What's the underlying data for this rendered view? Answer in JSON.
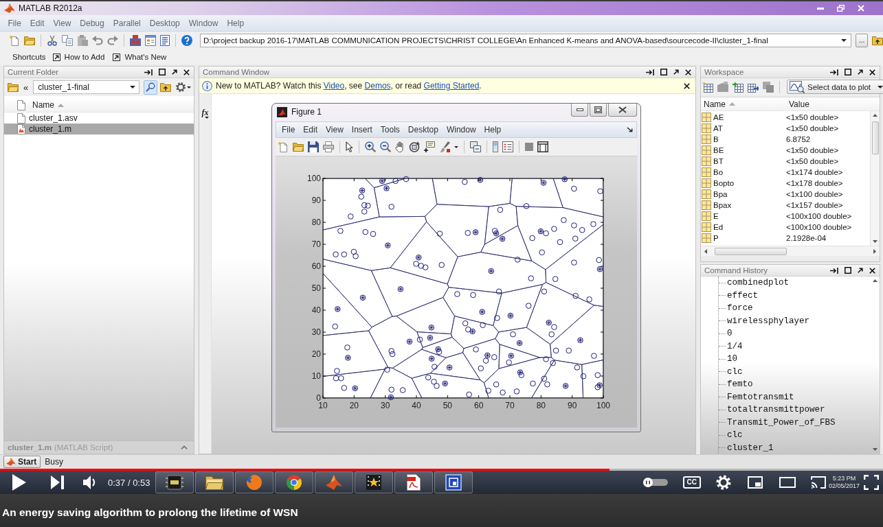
{
  "window": {
    "title": "MATLAB R2012a"
  },
  "menu": [
    "File",
    "Edit",
    "View",
    "Debug",
    "Parallel",
    "Desktop",
    "Window",
    "Help"
  ],
  "toolbar": {
    "current_folder": "D:\\project backup 2016-17\\MATLAB COMMUNICATION PROJECTS\\CHRIST COLLEGE\\An Enhanced K-means and ANOVA-based\\sourcecode-II\\cluster_1-final",
    "browse_button": "..."
  },
  "shortcuts": {
    "label": "Shortcuts",
    "links": [
      "How to Add",
      "What's New"
    ]
  },
  "current_folder": {
    "title": "Current Folder",
    "path_prefix": "«",
    "path": "cluster_1-final",
    "column": "Name",
    "files": [
      {
        "name": "cluster_1.asv",
        "kind": "file",
        "selected": false
      },
      {
        "name": "cluster_1.m",
        "kind": "script",
        "selected": true
      }
    ],
    "details": {
      "name": "cluster_1.m",
      "type": "(MATLAB Script)"
    }
  },
  "command_window": {
    "title": "Command Window",
    "notice": [
      {
        "kind": "text",
        "text": "New to MATLAB? Watch this "
      },
      {
        "kind": "link",
        "text": "Video"
      },
      {
        "kind": "text",
        "text": ", see "
      },
      {
        "kind": "link",
        "text": "Demos"
      },
      {
        "kind": "text",
        "text": ", or read "
      },
      {
        "kind": "link",
        "text": "Getting Started"
      },
      {
        "kind": "text",
        "text": "."
      }
    ],
    "function_browser": "fx"
  },
  "figure_window": {
    "title": "Figure 1",
    "menu": [
      "File",
      "Edit",
      "View",
      "Insert",
      "Tools",
      "Desktop",
      "Window",
      "Help"
    ],
    "chart_data": {
      "type": "scatter",
      "xlim": [
        10,
        100
      ],
      "ylim": [
        0,
        100
      ],
      "xticks": [
        10,
        20,
        30,
        40,
        50,
        60,
        70,
        80,
        90,
        100
      ],
      "yticks": [
        0,
        10,
        20,
        30,
        40,
        50,
        60,
        70,
        80,
        90,
        100
      ],
      "series": [
        {
          "color": "#1c1c78",
          "x": [
            36.7,
            33.3,
            55.5,
            22.3,
            23.3,
            24.4,
            23.3,
            32,
            18.9,
            15.6,
            23.6,
            26.1,
            14.1,
            16.8,
            19.9,
            20.5,
            39.9,
            41.5,
            42.9,
            48.1,
            47.5,
            56.5,
            66.9,
            75.3,
            90.6,
            99,
            87.3,
            90.6,
            93.2,
            96.8,
            84.2,
            81.6,
            77.2,
            91,
            86.1,
            80.3,
            90.6,
            98.6,
            72.5,
            76.8,
            84.6,
            66.5,
            58.2,
            53.1,
            81,
            95.5,
            91.1,
            76,
            65.9,
            61.3,
            55.7,
            56.6,
            71,
            84.2,
            83.4,
            13.9,
            41.1,
            17.8,
            32,
            32.3,
            47.3,
            59.1,
            62.3,
            65,
            69.7,
            81.6,
            83.8,
            84.8,
            88.9,
            97,
            91.6,
            14.5,
            14.2,
            15.8,
            16.8,
            30.6,
            32,
            35.6,
            43.8,
            45.6,
            46.5,
            45.8,
            56.9,
            60.7,
            65.6,
            63.1,
            67.7,
            72.2,
            73.7,
            77.4,
            81,
            82,
            93.6,
            98.2,
            98.2,
            65.2
          ],
          "values": [
            99.7,
            98.8,
            98.4,
            91.7,
            87.8,
            87.6,
            84.9,
            87.1,
            82.7,
            76.1,
            75.6,
            74.7,
            65.4,
            65.4,
            66.6,
            64.6,
            61.1,
            60.2,
            59.5,
            60.6,
            74.8,
            75.2,
            85.7,
            87.4,
            95.3,
            94.2,
            81,
            78.6,
            76.5,
            79.2,
            77,
            75,
            72.8,
            72.6,
            71,
            66.3,
            61.7,
            62.8,
            63,
            54.5,
            54.2,
            48.5,
            46.9,
            47.3,
            48.5,
            44.9,
            46.5,
            42,
            36.4,
            33.2,
            34,
            31.2,
            29,
            32.3,
            29,
            32.6,
            26.6,
            23,
            21.4,
            20,
            21,
            22.1,
            17,
            18.6,
            16.2,
            17.7,
            15.9,
            21.6,
            21.6,
            19.2,
            13.9,
            12.3,
            9,
            9,
            4.6,
            12.9,
            3.8,
            3.6,
            9.3,
            7.4,
            5.5,
            14.2,
            1.6,
            13.5,
            6.2,
            3.3,
            2.5,
            3,
            10.4,
            6.6,
            8.8,
            6.2,
            9.9,
            10.4,
            4.9,
            76.1
          ]
        },
        {
          "color": "#1c1c78",
          "x": [
            22.6,
            29,
            30.4,
            60.5,
            80.8,
            87.6,
            59,
            65.6,
            67.6,
            79.9,
            30.8,
            40.7,
            98.9,
            64,
            34.9,
            22.8,
            14.7,
            61.1,
            70.2,
            82.5,
            44.8,
            58,
            37.8,
            44.4,
            92.6,
            47,
            18,
            62.8,
            70.4,
            44.9,
            50.6,
            73.3,
            20.3,
            49.2,
            87.9,
            98.8,
            31.8,
            73.1
          ],
          "values": [
            94.5,
            98.8,
            95.5,
            99.3,
            98,
            99.6,
            75.5,
            75,
            72.5,
            75.9,
            69.5,
            64,
            58.7,
            57.8,
            49.6,
            45.7,
            40.5,
            39.2,
            37.5,
            34.3,
            32.1,
            30.3,
            25.7,
            27.4,
            26.3,
            22.2,
            18.3,
            19.4,
            19.2,
            17.9,
            13.9,
            11.7,
            4.4,
            6.6,
            5.5,
            5.8,
            0.3,
            25
          ]
        }
      ]
    }
  },
  "workspace": {
    "title": "Workspace",
    "plot_selector": "Select data to plot",
    "columns": [
      "Name",
      "Value"
    ],
    "rows": [
      {
        "name": "AE",
        "value": "<1x50 double>"
      },
      {
        "name": "AT",
        "value": "<1x50 double>"
      },
      {
        "name": "B",
        "value": "6.8752"
      },
      {
        "name": "BE",
        "value": "<1x50 double>"
      },
      {
        "name": "BT",
        "value": "<1x50 double>"
      },
      {
        "name": "Bo",
        "value": "<1x174 double>"
      },
      {
        "name": "Bopto",
        "value": "<1x178 double>"
      },
      {
        "name": "Bpa",
        "value": "<1x100 double>"
      },
      {
        "name": "Bpax",
        "value": "<1x157 double>"
      },
      {
        "name": "E",
        "value": "<100x100 double>"
      },
      {
        "name": "Ed",
        "value": "<100x100 double>"
      },
      {
        "name": "P",
        "value": "2.1928e-04"
      }
    ]
  },
  "command_history": {
    "title": "Command History",
    "items": [
      "combinedplot",
      "effect",
      "force",
      "wirelessphylayer",
      "0",
      "1/4",
      "10",
      "clc",
      "femto",
      "Femtotransmit",
      "totaltransmittpower",
      "Transmit_Power_of_FBS",
      "clc",
      "cluster_1"
    ]
  },
  "status_bar": {
    "start": "Start",
    "status": "Busy"
  },
  "video_player": {
    "progress": {
      "level": 0.69
    },
    "time": "0:37 / 0:53",
    "autoplay": {
      "on": false
    },
    "captions_button": "CC",
    "title": "An energy saving algorithm to prolong the lifetime of WSN"
  },
  "taskbar": {
    "clock": {
      "time": "5:23 PM",
      "date": "02/05/2017"
    }
  }
}
